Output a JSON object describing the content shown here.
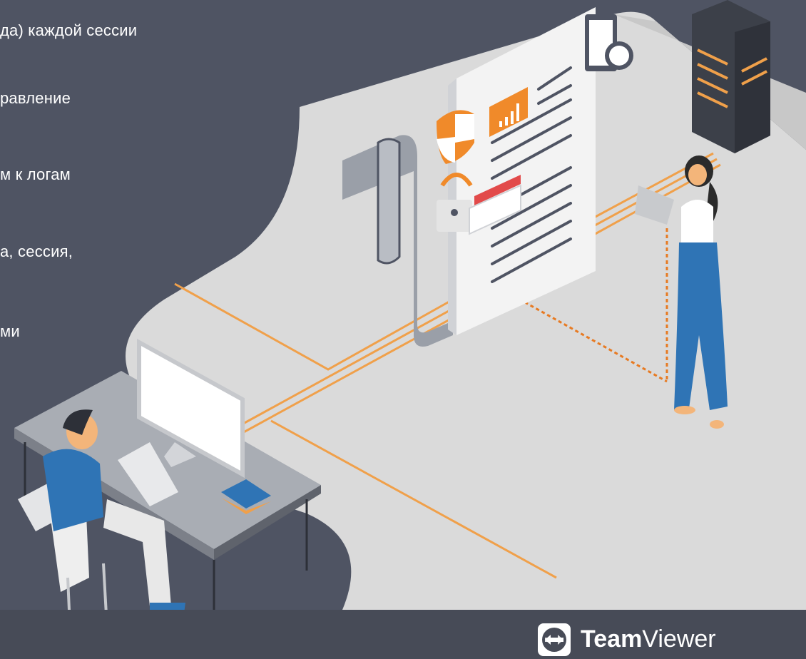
{
  "text_lines": [
    "да) каждой сессии",
    "равление",
    "м к логам",
    "а, сессия,",
    "ми"
  ],
  "logo": {
    "bold": "Team",
    "light": "Viewer"
  },
  "colors": {
    "background": "#4f5463",
    "floor": "#d9d9d9",
    "accent": "#f0a04a",
    "footer": "#474b57"
  }
}
